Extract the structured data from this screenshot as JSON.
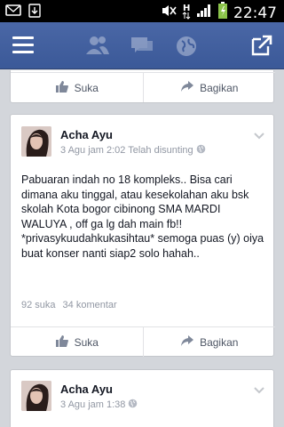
{
  "status_bar": {
    "time": "22:47",
    "icons": [
      "sms-icon",
      "download-icon",
      "mute-icon",
      "hspa-icon",
      "signal-icon",
      "battery-charging-icon"
    ],
    "network_label": "H"
  },
  "top_bar": {
    "bg_color": "#3b5998",
    "icons": [
      "menu-icon",
      "friends-icon",
      "messages-icon",
      "globe-icon",
      "share-icon"
    ]
  },
  "feed": {
    "top_card": {
      "like_label": "Suka",
      "share_label": "Bagikan"
    },
    "posts": [
      {
        "author": "Acha Ayu",
        "meta": "3 Agu jam 2:02 Telah disunting",
        "text": "Pabuaran indah no 18 kompleks.. Bisa cari dimana aku tinggal, atau kesekolahan aku bsk skolah Kota bogor cibinong SMA MARDI WALUYA , off ga lg dah main fb!! *privasykuudahkukasihtau* semoga puas (y) oiya buat konser nanti siap2 solo hahah..",
        "likes": "92 suka",
        "comments": "34 komentar",
        "like_label": "Suka",
        "share_label": "Bagikan"
      },
      {
        "author": "Acha Ayu",
        "meta": "3 Agu jam 1:38"
      }
    ]
  }
}
